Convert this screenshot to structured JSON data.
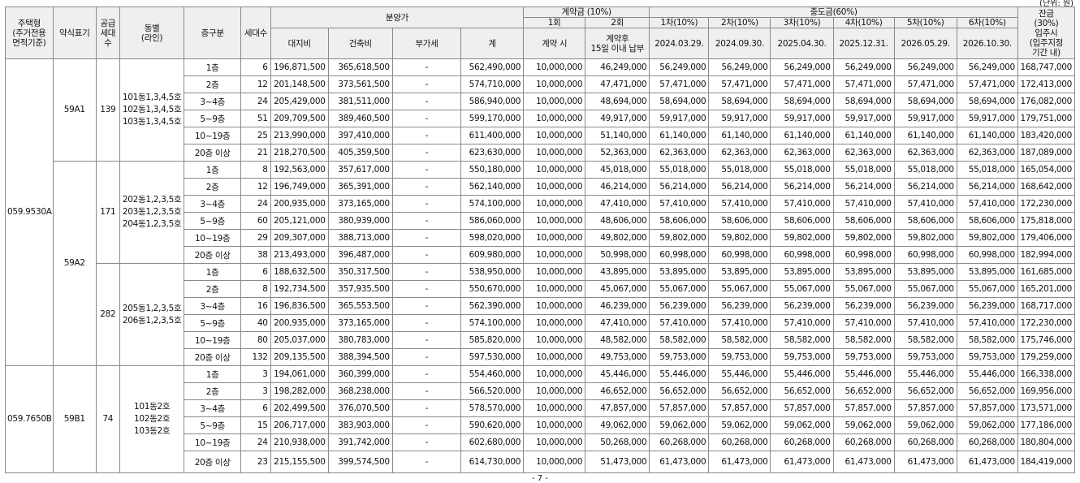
{
  "unit_note": "(단위: 원)",
  "page_number": "- 7 -",
  "header": {
    "housing_type": [
      "주택형",
      "(주거전용",
      "면적기준)"
    ],
    "abbrev": "약식표기",
    "supply_units": [
      "공급",
      "세대",
      "수"
    ],
    "building": [
      "동별",
      "(라인)"
    ],
    "floor_class": "층구분",
    "units": "세대수",
    "price_group": "분양가",
    "land": "대지비",
    "building_cost": "건축비",
    "vat": "부가세",
    "total": "계",
    "deposit_group": "계약금 (10%)",
    "dep1_round": "1회",
    "dep1_sub": "계약 시",
    "dep2_round": "2회",
    "dep2_sub": [
      "계약후",
      "15일 이내 납부"
    ],
    "mid_group": "중도금(60%)",
    "mid_labels": [
      "1차(10%)",
      "2차(10%)",
      "3차(10%)",
      "4차(10%)",
      "5차(10%)",
      "6차(10%)"
    ],
    "mid_dates": [
      "2024.03.29.",
      "2024.09.30.",
      "2025.04.30.",
      "2025.12.31.",
      "2026.05.29.",
      "2026.10.30."
    ],
    "balance": [
      "잔금",
      "(30%)",
      "입주시",
      "(입주지정",
      "기간 내)"
    ]
  },
  "groups": [
    {
      "housing_type": "059.9530A",
      "abbrev": "59A1",
      "supply": "139",
      "buildings": [
        "101동1,3,4,5호",
        "102동1,3,4,5호",
        "103동1,3,4,5호"
      ],
      "rows": [
        {
          "floor": "1층",
          "units": "6",
          "land": "196,871,500",
          "bld": "365,618,500",
          "vat": "-",
          "total": "562,490,000",
          "dep1": "10,000,000",
          "dep2": "46,249,000",
          "mid": "56,249,000",
          "bal": "168,747,000"
        },
        {
          "floor": "2층",
          "units": "12",
          "land": "201,148,500",
          "bld": "373,561,500",
          "vat": "-",
          "total": "574,710,000",
          "dep1": "10,000,000",
          "dep2": "47,471,000",
          "mid": "57,471,000",
          "bal": "172,413,000"
        },
        {
          "floor": "3~4층",
          "units": "24",
          "land": "205,429,000",
          "bld": "381,511,000",
          "vat": "-",
          "total": "586,940,000",
          "dep1": "10,000,000",
          "dep2": "48,694,000",
          "mid": "58,694,000",
          "bal": "176,082,000"
        },
        {
          "floor": "5~9층",
          "units": "51",
          "land": "209,709,500",
          "bld": "389,460,500",
          "vat": "-",
          "total": "599,170,000",
          "dep1": "10,000,000",
          "dep2": "49,917,000",
          "mid": "59,917,000",
          "bal": "179,751,000"
        },
        {
          "floor": "10~19층",
          "units": "25",
          "land": "213,990,000",
          "bld": "397,410,000",
          "vat": "-",
          "total": "611,400,000",
          "dep1": "10,000,000",
          "dep2": "51,140,000",
          "mid": "61,140,000",
          "bal": "183,420,000"
        },
        {
          "floor": "20층 이상",
          "units": "21",
          "land": "218,270,500",
          "bld": "405,359,500",
          "vat": "-",
          "total": "623,630,000",
          "dep1": "10,000,000",
          "dep2": "52,363,000",
          "mid": "62,363,000",
          "bal": "187,089,000"
        }
      ]
    },
    {
      "abbrev": "59A2",
      "supply": "171",
      "buildings": [
        "202동1,2,3,5호",
        "203동1,2,3,5호",
        "204동1,2,3,5호"
      ],
      "rows": [
        {
          "floor": "1층",
          "units": "8",
          "land": "192,563,000",
          "bld": "357,617,000",
          "vat": "-",
          "total": "550,180,000",
          "dep1": "10,000,000",
          "dep2": "45,018,000",
          "mid": "55,018,000",
          "bal": "165,054,000"
        },
        {
          "floor": "2층",
          "units": "12",
          "land": "196,749,000",
          "bld": "365,391,000",
          "vat": "-",
          "total": "562,140,000",
          "dep1": "10,000,000",
          "dep2": "46,214,000",
          "mid": "56,214,000",
          "bal": "168,642,000"
        },
        {
          "floor": "3~4층",
          "units": "24",
          "land": "200,935,000",
          "bld": "373,165,000",
          "vat": "-",
          "total": "574,100,000",
          "dep1": "10,000,000",
          "dep2": "47,410,000",
          "mid": "57,410,000",
          "bal": "172,230,000"
        },
        {
          "floor": "5~9층",
          "units": "60",
          "land": "205,121,000",
          "bld": "380,939,000",
          "vat": "-",
          "total": "586,060,000",
          "dep1": "10,000,000",
          "dep2": "48,606,000",
          "mid": "58,606,000",
          "bal": "175,818,000"
        },
        {
          "floor": "10~19층",
          "units": "29",
          "land": "209,307,000",
          "bld": "388,713,000",
          "vat": "-",
          "total": "598,020,000",
          "dep1": "10,000,000",
          "dep2": "49,802,000",
          "mid": "59,802,000",
          "bal": "179,406,000"
        },
        {
          "floor": "20층 이상",
          "units": "38",
          "land": "213,493,000",
          "bld": "396,487,000",
          "vat": "-",
          "total": "609,980,000",
          "dep1": "10,000,000",
          "dep2": "50,998,000",
          "mid": "60,998,000",
          "bal": "182,994,000"
        }
      ]
    },
    {
      "supply": "282",
      "buildings": [
        "205동1,2,3,5호",
        "206동1,2,3,5호"
      ],
      "rows": [
        {
          "floor": "1층",
          "units": "6",
          "land": "188,632,500",
          "bld": "350,317,500",
          "vat": "-",
          "total": "538,950,000",
          "dep1": "10,000,000",
          "dep2": "43,895,000",
          "mid": "53,895,000",
          "bal": "161,685,000"
        },
        {
          "floor": "2층",
          "units": "8",
          "land": "192,734,500",
          "bld": "357,935,500",
          "vat": "-",
          "total": "550,670,000",
          "dep1": "10,000,000",
          "dep2": "45,067,000",
          "mid": "55,067,000",
          "bal": "165,201,000"
        },
        {
          "floor": "3~4층",
          "units": "16",
          "land": "196,836,500",
          "bld": "365,553,500",
          "vat": "-",
          "total": "562,390,000",
          "dep1": "10,000,000",
          "dep2": "46,239,000",
          "mid": "56,239,000",
          "bal": "168,717,000"
        },
        {
          "floor": "5~9층",
          "units": "40",
          "land": "200,935,000",
          "bld": "373,165,000",
          "vat": "-",
          "total": "574,100,000",
          "dep1": "10,000,000",
          "dep2": "47,410,000",
          "mid": "57,410,000",
          "bal": "172,230,000"
        },
        {
          "floor": "10~19층",
          "units": "80",
          "land": "205,037,000",
          "bld": "380,783,000",
          "vat": "-",
          "total": "585,820,000",
          "dep1": "10,000,000",
          "dep2": "48,582,000",
          "mid": "58,582,000",
          "bal": "175,746,000"
        },
        {
          "floor": "20층 이상",
          "units": "132",
          "land": "209,135,500",
          "bld": "388,394,500",
          "vat": "-",
          "total": "597,530,000",
          "dep1": "10,000,000",
          "dep2": "49,753,000",
          "mid": "59,753,000",
          "bal": "179,259,000"
        }
      ]
    },
    {
      "housing_type": "059.7650B",
      "abbrev": "59B1",
      "supply": "74",
      "buildings": [
        "101동2호",
        "102동2호",
        "103동2호"
      ],
      "rows": [
        {
          "floor": "1층",
          "units": "3",
          "land": "194,061,000",
          "bld": "360,399,000",
          "vat": "-",
          "total": "554,460,000",
          "dep1": "10,000,000",
          "dep2": "45,446,000",
          "mid": "55,446,000",
          "bal": "166,338,000"
        },
        {
          "floor": "2층",
          "units": "3",
          "land": "198,282,000",
          "bld": "368,238,000",
          "vat": "-",
          "total": "566,520,000",
          "dep1": "10,000,000",
          "dep2": "46,652,000",
          "mid": "56,652,000",
          "bal": "169,956,000"
        },
        {
          "floor": "3~4층",
          "units": "6",
          "land": "202,499,500",
          "bld": "376,070,500",
          "vat": "-",
          "total": "578,570,000",
          "dep1": "10,000,000",
          "dep2": "47,857,000",
          "mid": "57,857,000",
          "bal": "173,571,000"
        },
        {
          "floor": "5~9층",
          "units": "15",
          "land": "206,717,000",
          "bld": "383,903,000",
          "vat": "-",
          "total": "590,620,000",
          "dep1": "10,000,000",
          "dep2": "49,062,000",
          "mid": "59,062,000",
          "bal": "177,186,000"
        },
        {
          "floor": "10~19층",
          "units": "24",
          "land": "210,938,000",
          "bld": "391,742,000",
          "vat": "-",
          "total": "602,680,000",
          "dep1": "10,000,000",
          "dep2": "50,268,000",
          "mid": "60,268,000",
          "bal": "180,804,000"
        },
        {
          "floor": "20층 이상",
          "units": "23",
          "land": "215,155,500",
          "bld": "399,574,500",
          "vat": "-",
          "total": "614,730,000",
          "dep1": "10,000,000",
          "dep2": "51,473,000",
          "mid": "61,473,000",
          "bal": "184,419,000"
        }
      ]
    }
  ]
}
